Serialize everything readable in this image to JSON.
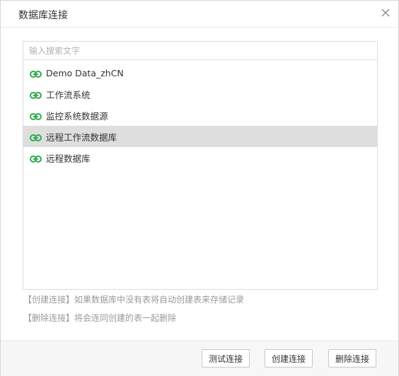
{
  "dialog": {
    "title": "数据库连接",
    "close_icon": "close-icon"
  },
  "search": {
    "placeholder": "输入搜索文字",
    "value": ""
  },
  "connections": [
    {
      "label": "Demo Data_zhCN",
      "icon": "link-icon",
      "selected": false
    },
    {
      "label": "工作流系统",
      "icon": "link-icon",
      "selected": false
    },
    {
      "label": "监控系统数据源",
      "icon": "link-icon",
      "selected": false
    },
    {
      "label": "远程工作流数据库",
      "icon": "link-icon",
      "selected": true
    },
    {
      "label": "远程数据库",
      "icon": "link-icon",
      "selected": false
    }
  ],
  "notes": {
    "create": "【创建连接】如果数据库中没有表将自动创建表来存储记录",
    "delete": "【删除连接】将会连同创建的表一起删除"
  },
  "footer": {
    "test_label": "测试连接",
    "create_label": "创建连接",
    "delete_label": "删除连接"
  },
  "colors": {
    "link_icon": "#2fab4b",
    "selected_row": "#dedede",
    "border": "#d6d6d6",
    "footer_bg": "#f7f7f7",
    "hint_text": "#9a9a9a"
  }
}
